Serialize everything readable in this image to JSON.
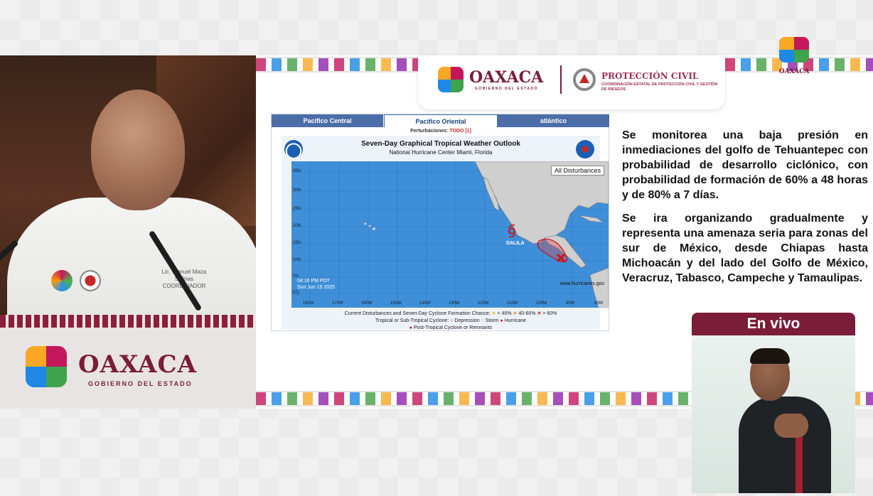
{
  "speaker": {
    "name_line1": "Lic. Manuel Maza Salinas",
    "name_line2": "COORDINADOR"
  },
  "podium": {
    "title": "OAXACA",
    "subtitle": "GOBIERNO DEL ESTADO"
  },
  "header": {
    "oaxaca": "OAXACA",
    "oaxaca_sub": "GOBIERNO DEL ESTADO",
    "pc_title": "PROTECCIÓN CIVIL",
    "pc_sub": "COORDINACIÓN ESTATAL DE PROTECCIÓN CIVIL Y GESTIÓN DE RIESGOS"
  },
  "corner": {
    "label": "OAXACA"
  },
  "outlook": {
    "tabs": [
      "Pacifico Central",
      "Pacifico Oriental",
      "atlántico"
    ],
    "perturb_label": "Perturbaciones:",
    "perturb_value": "TODO [1]",
    "title": "Seven-Day Graphical Tropical Weather Outlook",
    "subtitle": "National Hurricane Center  Miami, Florida",
    "all_disturbances": "All Disturbances",
    "storm_label": "DALILA",
    "timestamp_1": "04:16 PM PDT",
    "timestamp_2": "Sun Jun 15 2025",
    "url": "www.hurricanes.gov",
    "lat_labels": [
      "35N",
      "30N",
      "25N",
      "20N",
      "15N",
      "10N",
      "5N",
      "EQ"
    ],
    "lon_labels": [
      "180W",
      "170W",
      "160W",
      "150W",
      "140W",
      "130W",
      "120W",
      "110W",
      "100W",
      "90W",
      "80W"
    ],
    "legend_line1": "Current Disturbances and Seven-Day Cyclone Formation Chance:",
    "legend_low": "< 40%",
    "legend_mid": "40-60%",
    "legend_high": "> 60%",
    "legend_line2": "Tropical or Sub-Tropical Cyclone:",
    "legend_depression": "Depression",
    "legend_storm": "Storm",
    "legend_hurricane": "Hurricane",
    "legend_line3": "Post-Tropical Cyclone or Remnants"
  },
  "slide_text": {
    "p1": "Se monitorea una baja presión en inmediaciones del golfo de Tehuantepec con probabilidad de desarrollo ciclónico, con probabilidad de formación de 60% a 48 horas y de 80% a 7 días.",
    "p2": "Se ira organizando gradualmente y representa una amenaza seria para zonas del sur de México, desde Chiapas hasta Michoacán y del lado del Golfo de México, Veracruz, Tabasco, Campeche y Tamaulipas."
  },
  "live": {
    "label": "En vivo"
  },
  "colors": {
    "brand": "#7b1c38",
    "ocean": "#3f8fd8",
    "tab_blue": "#4c6ea8"
  }
}
